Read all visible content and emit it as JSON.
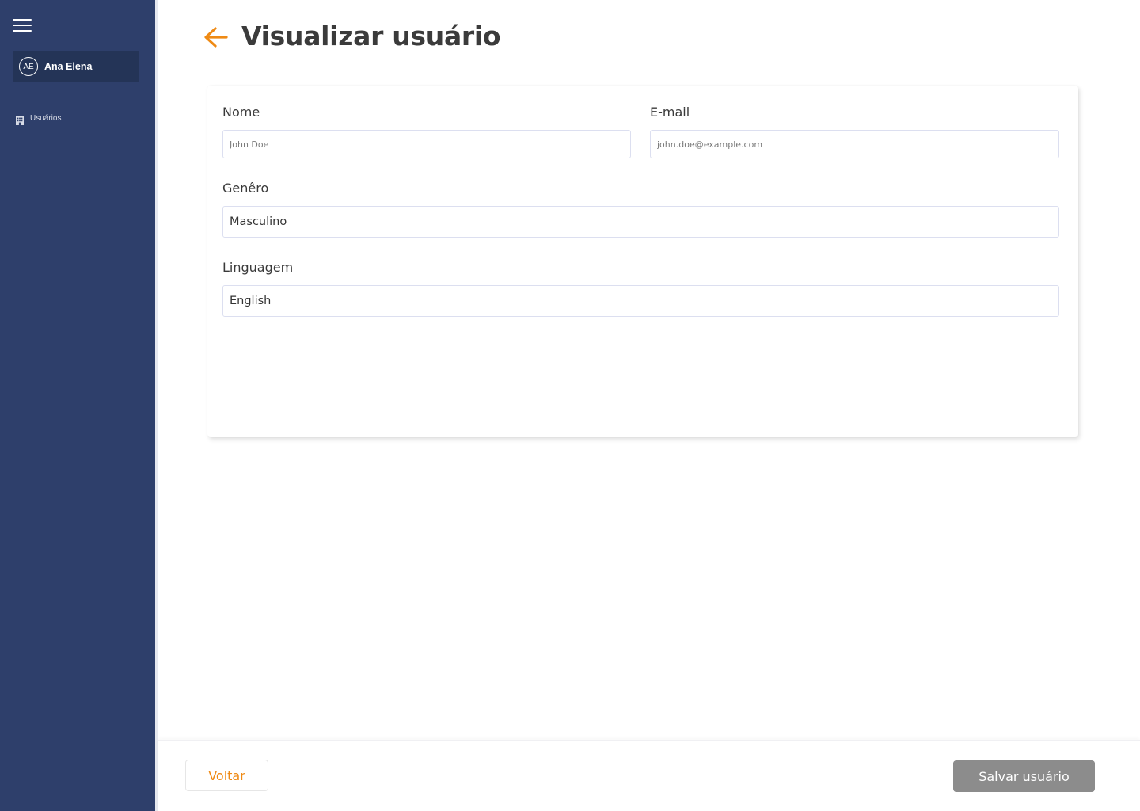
{
  "sidebar": {
    "user": {
      "initials": "AE",
      "name": "Ana Elena"
    },
    "items": [
      {
        "label": "Usuários",
        "icon": "building-icon"
      }
    ]
  },
  "header": {
    "title": "Visualizar usuário",
    "back_icon": "arrow-left-icon"
  },
  "form": {
    "nome": {
      "label": "Nome",
      "placeholder": "John Doe"
    },
    "email": {
      "label": "E-mail",
      "placeholder": "john.doe@example.com"
    },
    "genero": {
      "label": "Genêro",
      "value": "Masculino"
    },
    "linguagem": {
      "label": "Linguagem",
      "value": "English"
    }
  },
  "footer": {
    "back_label": "Voltar",
    "save_label": "Salvar usuário"
  },
  "colors": {
    "sidebar": "#2e3f6b",
    "accent": "#ef8a14",
    "disabled_button": "#8c8c8c"
  }
}
